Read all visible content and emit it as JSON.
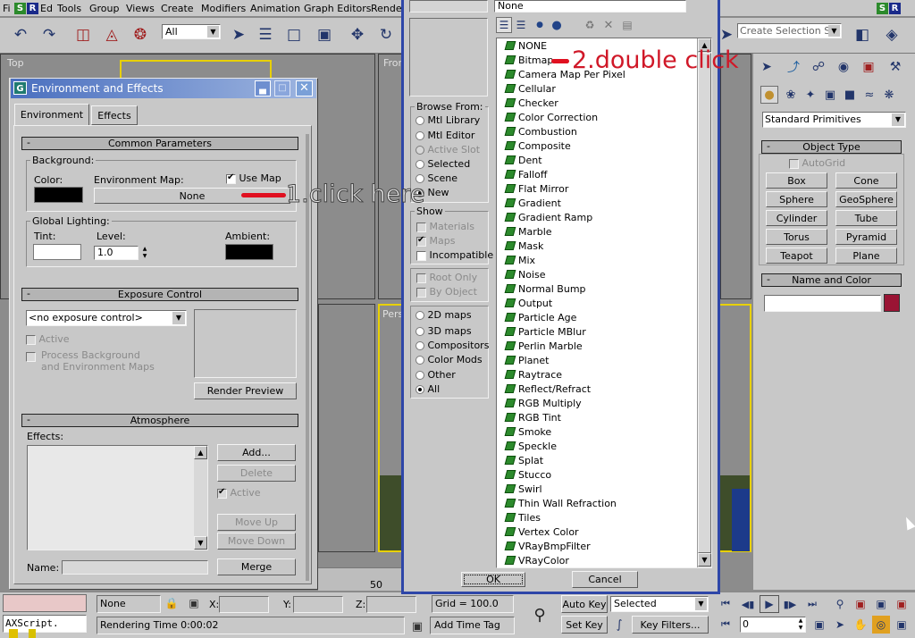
{
  "menubar": {
    "items": [
      "File",
      "Edit",
      "Tools",
      "Group",
      "Views",
      "Create",
      "Modifiers",
      "Animation",
      "Graph Editors",
      "Rende"
    ],
    "file_visible": "Fi",
    "edit_visible": "Ed"
  },
  "toolbar": {
    "selection_filter": "All",
    "named_selection": "Create Selection Set"
  },
  "viewports": {
    "top_label": "Top",
    "front_label": "Fron",
    "persp_label": "Pers"
  },
  "env_dialog": {
    "title": "Environment and Effects",
    "tabs": [
      "Environment",
      "Effects"
    ],
    "common_params": "Common Parameters",
    "background_label": "Background:",
    "color_label": "Color:",
    "env_map_label": "Environment Map:",
    "use_map_label": "Use Map",
    "env_map_button": "None",
    "global_lighting_label": "Global Lighting:",
    "tint_label": "Tint:",
    "level_label": "Level:",
    "level_value": "1.0",
    "ambient_label": "Ambient:",
    "exposure_header": "Exposure Control",
    "exposure_select": "<no exposure control>",
    "active_label": "Active",
    "process_bg_label_1": "Process Background",
    "process_bg_label_2": "and Environment Maps",
    "render_preview": "Render Preview",
    "atmosphere_header": "Atmosphere",
    "effects_label": "Effects:",
    "add_button": "Add...",
    "delete_button": "Delete",
    "atmo_active_label": "Active",
    "move_up": "Move Up",
    "move_down": "Move Down",
    "name_label": "Name:",
    "merge_button": "Merge"
  },
  "browser": {
    "top_field": "None",
    "browse_from_label": "Browse From:",
    "browse_from": [
      "Mtl Library",
      "Mtl Editor",
      "Active Slot",
      "Selected",
      "Scene",
      "New"
    ],
    "show_label": "Show",
    "show_items": [
      "Materials",
      "Maps",
      "Incompatible"
    ],
    "root_only": "Root Only",
    "by_object": "By Object",
    "filters": [
      "2D maps",
      "3D maps",
      "Compositors",
      "Color Mods",
      "Other",
      "All"
    ],
    "maps": [
      "NONE",
      "Bitmap",
      "Camera Map Per Pixel",
      "Cellular",
      "Checker",
      "Color Correction",
      "Combustion",
      "Composite",
      "Dent",
      "Falloff",
      "Flat Mirror",
      "Gradient",
      "Gradient Ramp",
      "Marble",
      "Mask",
      "Mix",
      "Noise",
      "Normal Bump",
      "Output",
      "Particle Age",
      "Particle MBlur",
      "Perlin Marble",
      "Planet",
      "Raytrace",
      "Reflect/Refract",
      "RGB Multiply",
      "RGB Tint",
      "Smoke",
      "Speckle",
      "Splat",
      "Stucco",
      "Swirl",
      "Thin Wall Refraction",
      "Tiles",
      "Vertex Color",
      "VRayBmpFilter",
      "VRayColor"
    ],
    "ok": "OK",
    "cancel": "Cancel"
  },
  "command_panel": {
    "category": "Standard Primitives",
    "object_type_header": "Object Type",
    "autogrid": "AutoGrid",
    "buttons": [
      "Box",
      "Cone",
      "Sphere",
      "GeoSphere",
      "Cylinder",
      "Tube",
      "Torus",
      "Pyramid",
      "Teapot",
      "Plane"
    ],
    "name_color_header": "Name and Color"
  },
  "status": {
    "maxscript": "AXScript.",
    "selection": "None Selecte",
    "x_label": "X:",
    "y_label": "Y:",
    "z_label": "Z:",
    "grid": "Grid = 100.0",
    "rendering_time": "Rendering Time  0:00:02",
    "add_time_tag": "Add Time Tag",
    "auto_key": "Auto Key",
    "set_key": "Set Key",
    "selected_dropdown": "Selected",
    "key_filters": "Key Filters...",
    "frame": "0",
    "timeline_mark": "50"
  },
  "annotations": {
    "step1": "1.click here",
    "step2": "2.double click"
  },
  "colors": {
    "title_active": "#5a80c8",
    "browser_border": "#2e46a8",
    "annotation_red": "#e01020",
    "viewport_yellow": "#e8d000",
    "map_icon": "#2c8a2c",
    "name_swatch": "#9a1434"
  }
}
